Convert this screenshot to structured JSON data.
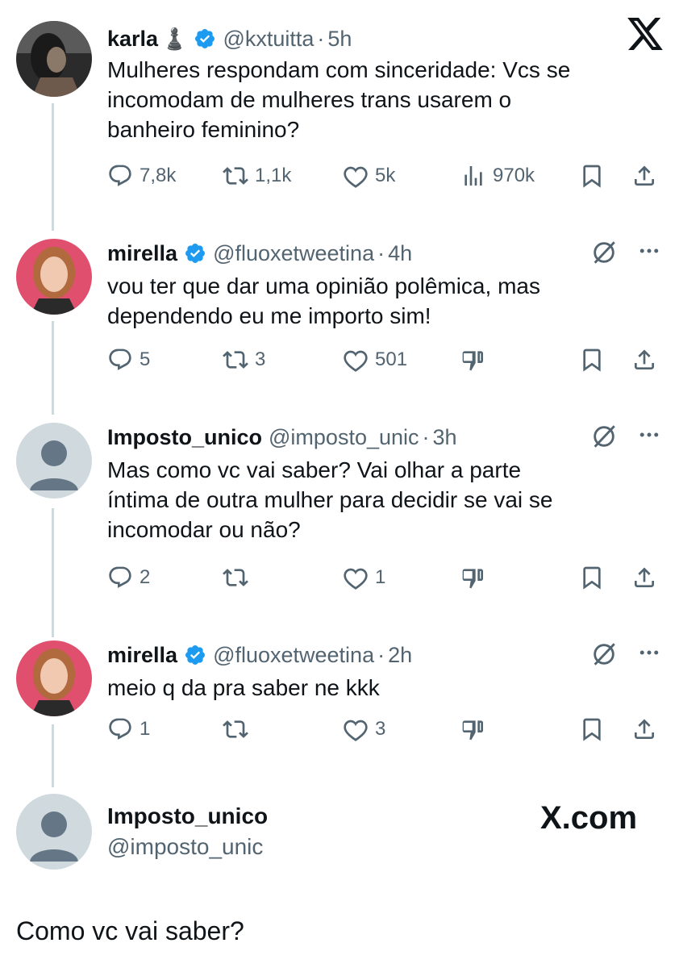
{
  "tweets": [
    {
      "name": "karla",
      "emoji": "♟️",
      "handle": "@kxtuitta",
      "time": "5h",
      "lines": [
        "Mulheres respondam com sinceridade: Vcs se",
        "incomodam de mulheres trans usarem o",
        "banheiro feminino?"
      ],
      "replies": "7,8k",
      "retweets": "1,1k",
      "likes": "5k",
      "views": "970k"
    },
    {
      "name": "mirella",
      "handle": "@fluoxetweetina",
      "time": "4h",
      "lines": [
        "vou ter que dar uma opinião polêmica, mas",
        "dependendo eu me importo sim!"
      ],
      "replies": "5",
      "retweets": "3",
      "likes": "501"
    },
    {
      "name": "Imposto_unico",
      "handle": "@imposto_unic",
      "time": "3h",
      "lines": [
        "Mas como vc vai saber? Vai olhar a parte",
        "íntima de outra mulher para decidir se vai se",
        "incomodar ou não?"
      ],
      "replies": "2",
      "retweets": "",
      "likes": "1"
    },
    {
      "name": "mirella",
      "handle": "@fluoxetweetina",
      "time": "2h",
      "lines": [
        "meio q da pra saber ne kkk"
      ],
      "replies": "1",
      "retweets": "",
      "likes": "3"
    }
  ],
  "composer": {
    "name": "Imposto_unico",
    "handle": "@imposto_unic",
    "brand": "X.com",
    "text": "Como vc vai saber?"
  },
  "colors": {
    "verified": "#1d9bf0",
    "muted": "#536471",
    "line": "#cfd9de"
  }
}
